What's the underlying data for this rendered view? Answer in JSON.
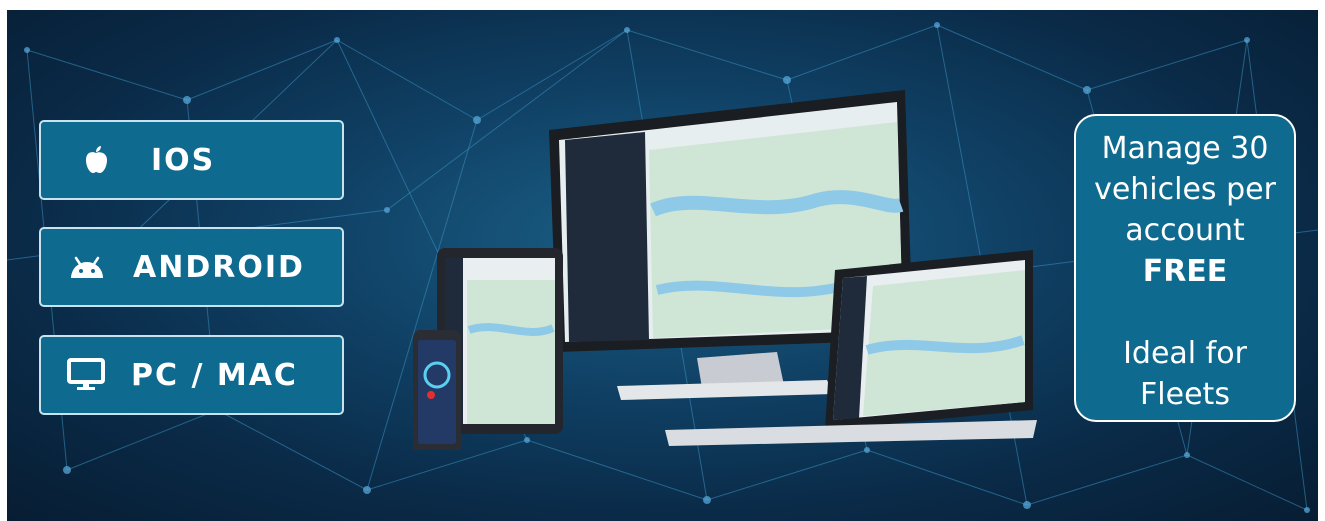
{
  "platforms": [
    {
      "label": "IOS",
      "icon": "apple-icon"
    },
    {
      "label": "ANDROID",
      "icon": "android-icon"
    },
    {
      "label": "PC / MAC",
      "icon": "monitor-icon"
    }
  ],
  "info": {
    "line1": "Manage 30",
    "line2": "vehicles per",
    "line3": "account",
    "line4": "FREE",
    "line5": "Ideal for",
    "line6": "Fleets"
  },
  "colors": {
    "button_bg": "#0f6a8f",
    "button_border": "#c9e3ee",
    "background_dark": "#0a2a47",
    "network_lines": "#3a8fc0"
  }
}
